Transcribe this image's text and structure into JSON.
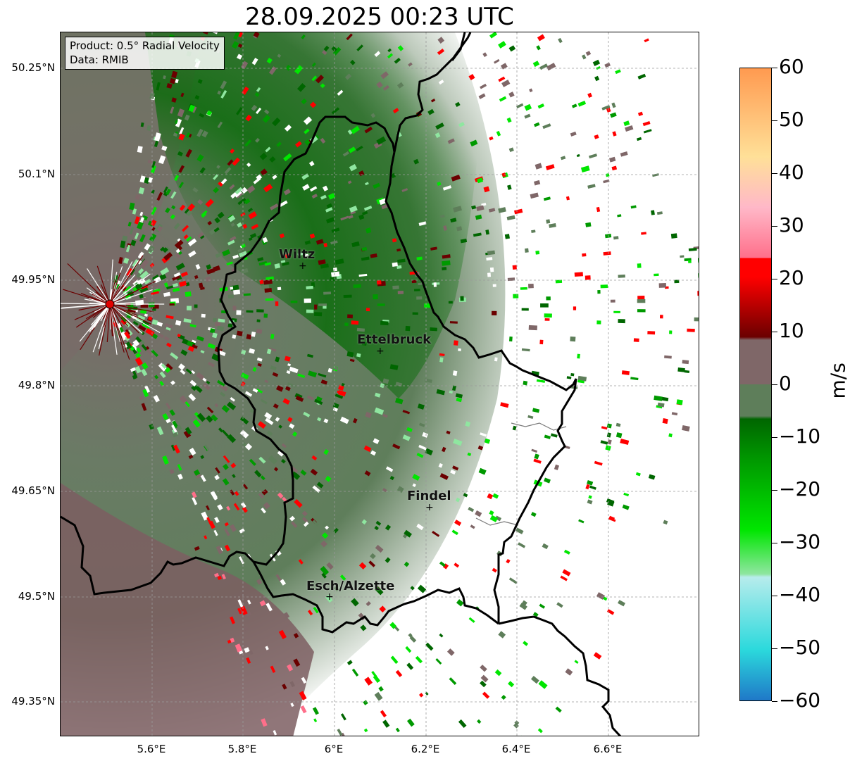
{
  "title": "28.09.2025 00:23 UTC",
  "info_box": {
    "line1": "Product: 0.5° Radial Velocity",
    "line2": "Data: RMIB"
  },
  "map": {
    "lat_ticks": [
      "50.25°N",
      "50.1°N",
      "49.95°N",
      "49.8°N",
      "49.65°N",
      "49.5°N",
      "49.35°N"
    ],
    "lon_ticks": [
      "5.6°E",
      "5.8°E",
      "6°E",
      "6.2°E",
      "6.4°E",
      "6.6°E"
    ],
    "cities": [
      {
        "name": "Wiltz"
      },
      {
        "name": "Ettelbruck"
      },
      {
        "name": "Findel"
      },
      {
        "name": "Esch/Alzette"
      }
    ],
    "radar_site": "red-circle-marker"
  },
  "colorbar": {
    "unit": "m/s",
    "ticks": [
      "60",
      "50",
      "40",
      "30",
      "20",
      "10",
      "0",
      "−10",
      "−20",
      "−30",
      "−40",
      "−50",
      "−60"
    ],
    "min": -60,
    "max": 60,
    "colors": {
      "neg_max": "#1f78c8",
      "cyan": "#2bd9dc",
      "light_cyan": "#b7ecec",
      "light_green": "#8fe6a0",
      "bright_green": "#00e600",
      "green": "#009900",
      "dark_green": "#006600",
      "gray_green": "#5e7e5a",
      "gray_rose": "#7f6768",
      "dark_red": "#6b0000",
      "red": "#ff0000",
      "pink": "#ff6f8a",
      "light_pink": "#ffb8c8",
      "light_orange": "#ffe098",
      "orange": "#ff9a50"
    }
  }
}
